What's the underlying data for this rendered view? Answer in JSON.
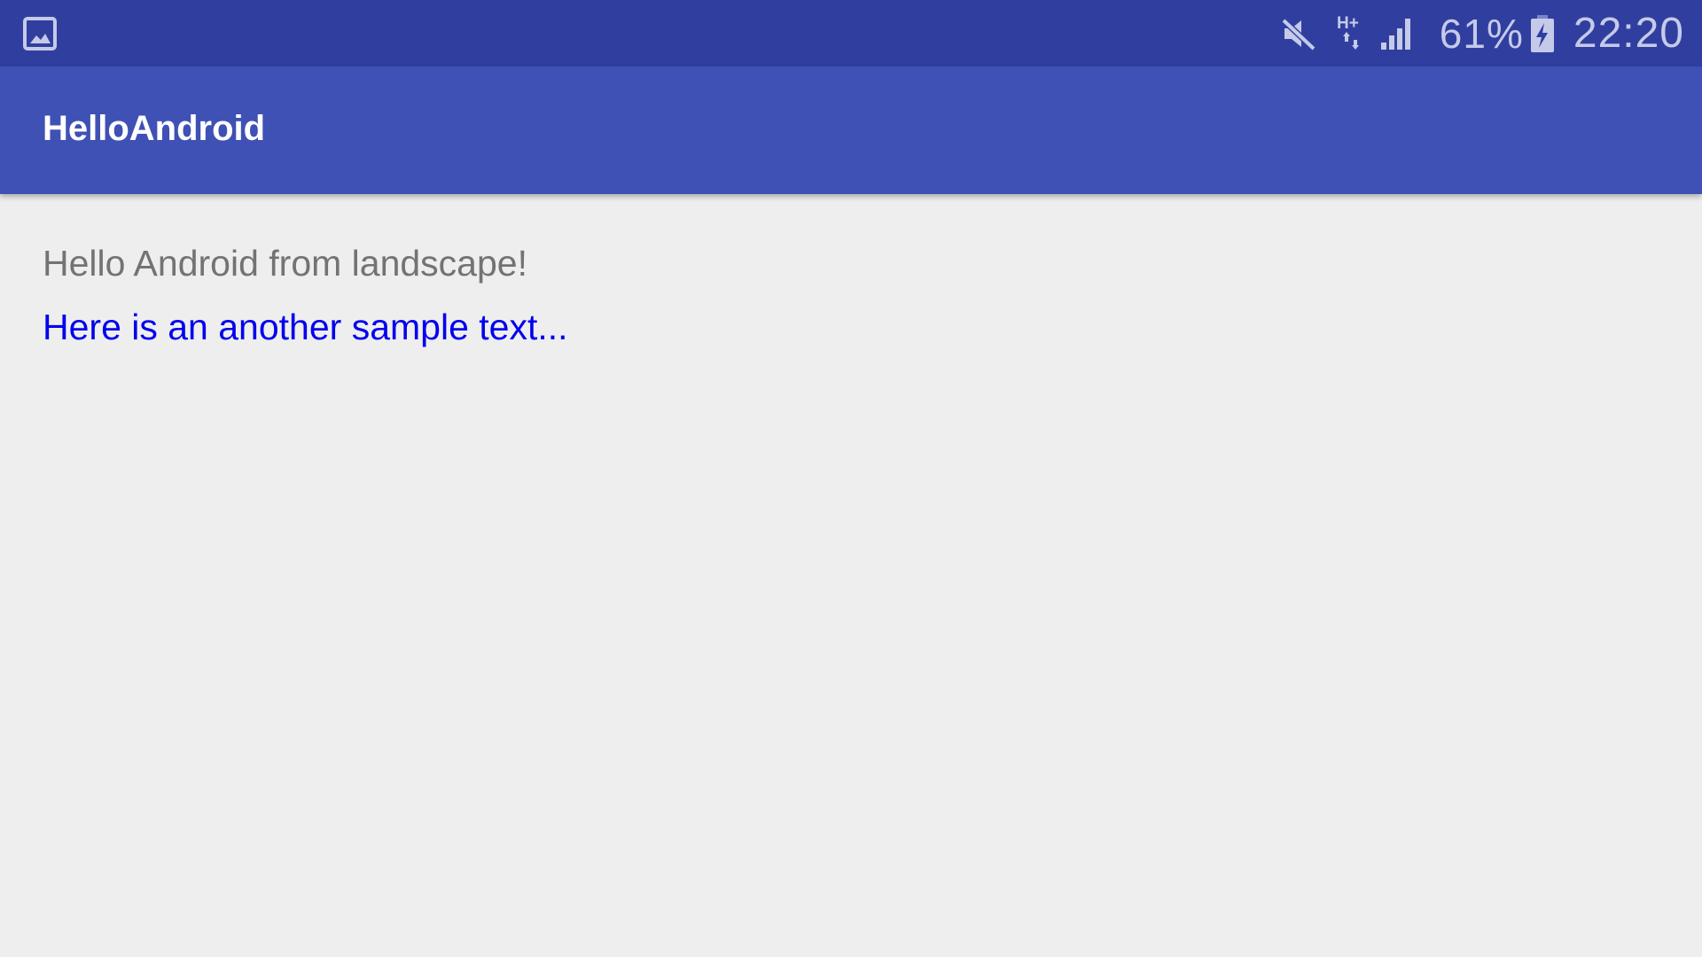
{
  "status_bar": {
    "notification_icon": "image-icon",
    "icons": [
      "mute-icon",
      "h-plus-network-icon",
      "signal-icon",
      "battery-charging-icon"
    ],
    "network_label": "H+",
    "battery_percent": "61%",
    "time": "22:20",
    "color": "#303f9f"
  },
  "app_bar": {
    "title": "HelloAndroid",
    "color": "#3f51b5"
  },
  "content": {
    "text_primary": "Hello Android from landscape!",
    "text_secondary": "Here is an another sample text...",
    "text_secondary_color": "#0000ee",
    "background": "#eeeeee"
  }
}
